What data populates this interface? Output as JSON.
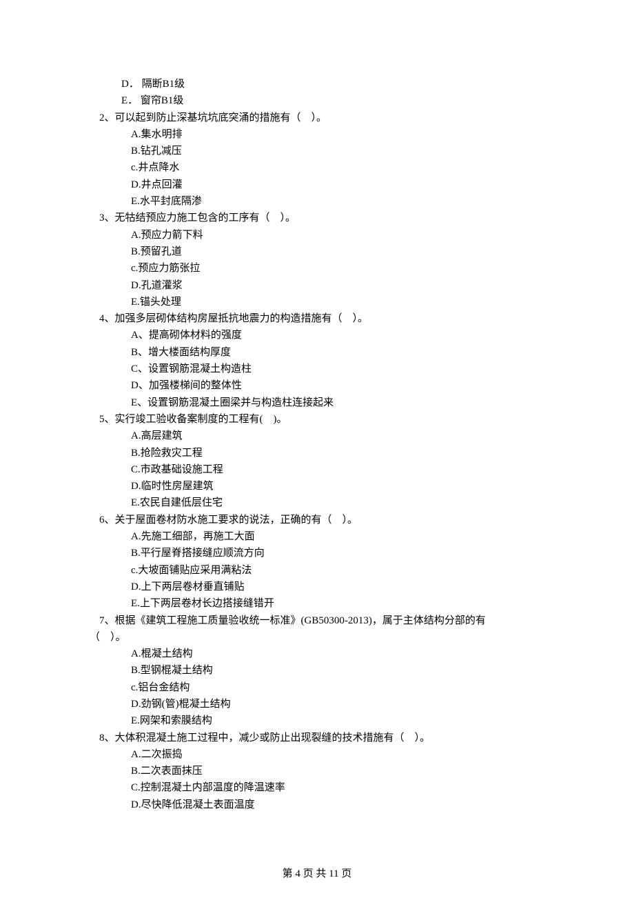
{
  "orphan_options": [
    {
      "label": "D．",
      "text": "隔断B1级"
    },
    {
      "label": "E．",
      "text": "窗帘B1级"
    }
  ],
  "questions": [
    {
      "number": "2、",
      "stem": "可以起到防止深基坑坑底突涌的措施有（    ）。",
      "options": [
        {
          "label": "A.",
          "text": "集水明排"
        },
        {
          "label": "B.",
          "text": "钻孔减压"
        },
        {
          "label": "c.",
          "text": "井点降水"
        },
        {
          "label": "D.",
          "text": "井点回灌"
        },
        {
          "label": "E.",
          "text": "水平封底隔渗"
        }
      ],
      "opt_style": "tight"
    },
    {
      "number": "3、",
      "stem": "无牯结预应力施工包含的工序有（    ）。",
      "options": [
        {
          "label": "A.",
          "text": "预应力箭下料"
        },
        {
          "label": "B.",
          "text": "预留孔道"
        },
        {
          "label": "c.",
          "text": "预应力筋张拉"
        },
        {
          "label": "D.",
          "text": "孔道灌浆"
        },
        {
          "label": "E.",
          "text": "锚头处理"
        }
      ],
      "opt_style": "tight"
    },
    {
      "number": "4、",
      "stem": "加强多层砌体结构房屋抵抗地震力的构造措施有（    ）。",
      "options": [
        {
          "label": "A、",
          "text": "提高砌体材料的强度"
        },
        {
          "label": "B、",
          "text": "增大楼面结构厚度"
        },
        {
          "label": "C、",
          "text": "设置钢筋混凝土构造柱"
        },
        {
          "label": "D、",
          "text": "加强楼梯间的整体性"
        },
        {
          "label": "E、",
          "text": "设置钢筋混凝土圈梁并与构造柱连接起来"
        }
      ],
      "opt_style": "tight"
    },
    {
      "number": "5、",
      "stem": "实行竣工验收备案制度的工程有(    )。",
      "options": [
        {
          "label": "A.",
          "text": "高层建筑"
        },
        {
          "label": "B.",
          "text": "抢险救灾工程"
        },
        {
          "label": "C.",
          "text": "市政基础设施工程"
        },
        {
          "label": "D.",
          "text": "临时性房屋建筑"
        },
        {
          "label": "E.",
          "text": "农民自建低层住宅"
        }
      ],
      "opt_style": "tight"
    },
    {
      "number": "6、",
      "stem": "关于屋面卷材防水施工要求的说法，正确的有（    ）。",
      "options": [
        {
          "label": "A.",
          "text": "先施工细部，再施工大面"
        },
        {
          "label": "B.",
          "text": "平行屋脊搭接缝应顺流方向"
        },
        {
          "label": "c.",
          "text": "大坡面铺贴应采用满粘法"
        },
        {
          "label": "D.",
          "text": "上下两层卷材垂直铺贴"
        },
        {
          "label": "E.",
          "text": "上下两层卷材长边搭接缝错开"
        }
      ],
      "opt_style": "tight"
    },
    {
      "number": "7、",
      "stem_lines": [
        "根据《建筑工程施工质量验收统一标准》(GB50300-2013)，属于主体结构分部的有",
        "（    ）。"
      ],
      "options": [
        {
          "label": "A.",
          "text": "棍凝土结构"
        },
        {
          "label": "B.",
          "text": "型钢棍凝土结构"
        },
        {
          "label": "c.",
          "text": "铝台金结构"
        },
        {
          "label": "D.",
          "text": "劲钢(管)棍凝土结构"
        },
        {
          "label": "E.",
          "text": "网架和索膜结构"
        }
      ],
      "opt_style": "tight"
    },
    {
      "number": "8、",
      "stem": "大体积混凝土施工过程中，减少或防止出现裂缝的技术措施有（    ）。",
      "options": [
        {
          "label": "A.",
          "text": "二次振捣"
        },
        {
          "label": "B.",
          "text": "二次表面抹压"
        },
        {
          "label": "C.",
          "text": "控制混凝土内部温度的降温速率"
        },
        {
          "label": "D.",
          "text": "尽快降低混凝土表面温度"
        }
      ],
      "opt_style": "tight"
    }
  ],
  "footer": "第 4 页 共 11 页"
}
